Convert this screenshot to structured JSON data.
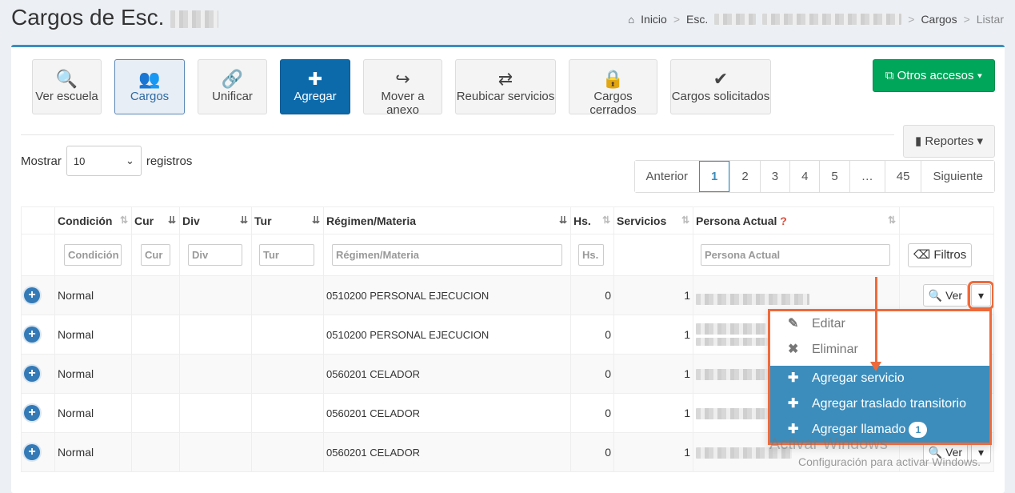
{
  "header": {
    "title": "Cargos de Esc.",
    "breadcrumb": {
      "home": "Inicio",
      "esc": "Esc.",
      "cargos": "Cargos",
      "listar": "Listar"
    }
  },
  "toolbar": [
    {
      "label": "Ver escuela",
      "icon": "search-icon",
      "glyph": "🔍"
    },
    {
      "label": "Cargos",
      "icon": "users-icon",
      "glyph": "👥"
    },
    {
      "label": "Unificar",
      "icon": "link-icon",
      "glyph": "🔗"
    },
    {
      "label": "Agregar",
      "icon": "plus-icon",
      "glyph": "✚"
    },
    {
      "label": "Mover a anexo",
      "icon": "share-icon",
      "glyph": "↪"
    },
    {
      "label": "Reubicar servicios",
      "icon": "exchange-icon",
      "glyph": "⇄"
    },
    {
      "label": "Cargos cerrados",
      "icon": "lock-icon",
      "glyph": "🔒"
    },
    {
      "label": "Cargos solicitados",
      "icon": "check-icon",
      "glyph": "✔"
    }
  ],
  "otros_accesos": "Otros accesos",
  "reportes": "Reportes",
  "length": {
    "prefix": "Mostrar",
    "value": "10",
    "suffix": "registros"
  },
  "pagination": [
    "Anterior",
    "1",
    "2",
    "3",
    "4",
    "5",
    "…",
    "45",
    "Siguiente"
  ],
  "columns": [
    "Condición",
    "Cur",
    "Div",
    "Tur",
    "Régimen/Materia",
    "Hs.",
    "Servicios",
    "Persona Actual"
  ],
  "filters": {
    "condicion": "Condición",
    "cur": "Cur",
    "div": "Div",
    "tur": "Tur",
    "regimen": "Régimen/Materia",
    "hs": "Hs.",
    "persona": "Persona Actual",
    "button": "Filtros"
  },
  "rows": [
    {
      "condicion": "Normal",
      "regimen": "0510200 PERSONAL EJECUCION",
      "hs": "0",
      "servicios": "1"
    },
    {
      "condicion": "Normal",
      "regimen": "0510200 PERSONAL EJECUCION",
      "hs": "0",
      "servicios": "1"
    },
    {
      "condicion": "Normal",
      "regimen": "0560201 CELADOR",
      "hs": "0",
      "servicios": "1"
    },
    {
      "condicion": "Normal",
      "regimen": "0560201 CELADOR",
      "hs": "0",
      "servicios": "1"
    },
    {
      "condicion": "Normal",
      "regimen": "0560201 CELADOR",
      "hs": "0",
      "servicios": "1"
    }
  ],
  "row_action": "Ver",
  "dropdown": [
    {
      "label": "Editar",
      "glyph": "✎"
    },
    {
      "label": "Eliminar",
      "glyph": "✖"
    },
    {
      "label": "Agregar servicio",
      "glyph": "✚"
    },
    {
      "label": "Agregar traslado transitorio",
      "glyph": "✚"
    },
    {
      "label": "Agregar llamado",
      "glyph": "✚",
      "badge": "1"
    }
  ],
  "watermark": {
    "line1": "Activar Windows",
    "line2": "Configuración para activar Windows."
  }
}
